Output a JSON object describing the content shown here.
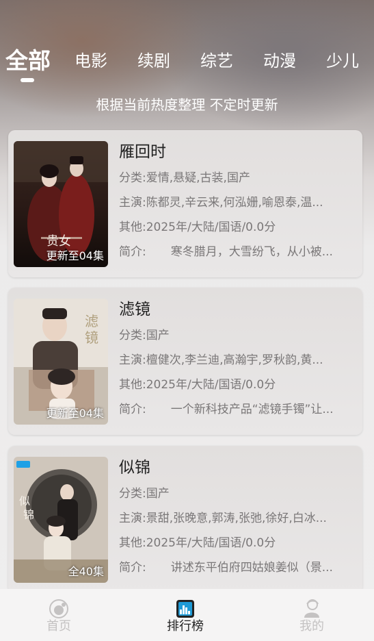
{
  "tabs": [
    {
      "label": "全部",
      "active": true
    },
    {
      "label": "电影",
      "active": false
    },
    {
      "label": "续剧",
      "active": false
    },
    {
      "label": "综艺",
      "active": false
    },
    {
      "label": "动漫",
      "active": false
    },
    {
      "label": "少儿",
      "active": false
    }
  ],
  "subtitle": "根据当前热度整理 不定时更新",
  "items": [
    {
      "title": "雁回时",
      "episode": "更新至04集",
      "poster_text": "贵女",
      "category_key": "分类:",
      "category": "爱情,悬疑,古装,国产",
      "cast_key": "主演:",
      "cast": "陈都灵,辛云来,何泓姗,喻恩泰,温...",
      "other_key": "其他:",
      "other": "2025年/大陆/国语/0.0分",
      "intro_key": "简介:",
      "intro": "寒冬腊月，大雪纷飞，从小被..."
    },
    {
      "title": "滤镜",
      "episode": "更新至04集",
      "poster_text": "滤镜",
      "category_key": "分类:",
      "category": "国产",
      "cast_key": "主演:",
      "cast": "檀健次,李兰迪,高瀚宇,罗秋韵,黄...",
      "other_key": "其他:",
      "other": "2025年/大陆/国语/0.0分",
      "intro_key": "简介:",
      "intro": "一个新科技产品“滤镜手镯”让..."
    },
    {
      "title": "似锦",
      "episode": "全40集",
      "poster_text": "似锦",
      "category_key": "分类:",
      "category": "国产",
      "cast_key": "主演:",
      "cast": "景甜,张晚意,郭涛,张弛,徐好,白冰...",
      "other_key": "其他:",
      "other": "2025年/大陆/国语/0.0分",
      "intro_key": "简介:",
      "intro": "讲述东平伯府四姑娘姜似（景..."
    }
  ],
  "bottom_nav": [
    {
      "label": "首页",
      "icon": "home-icon",
      "active": false
    },
    {
      "label": "排行榜",
      "icon": "ranking-icon",
      "active": true
    },
    {
      "label": "我的",
      "icon": "profile-icon",
      "active": false
    }
  ],
  "colors": {
    "active_text": "#222222",
    "inactive_nav": "#c4c2c2",
    "meta_text": "#7a7778",
    "ranking_accent": "#1e9ad6"
  }
}
